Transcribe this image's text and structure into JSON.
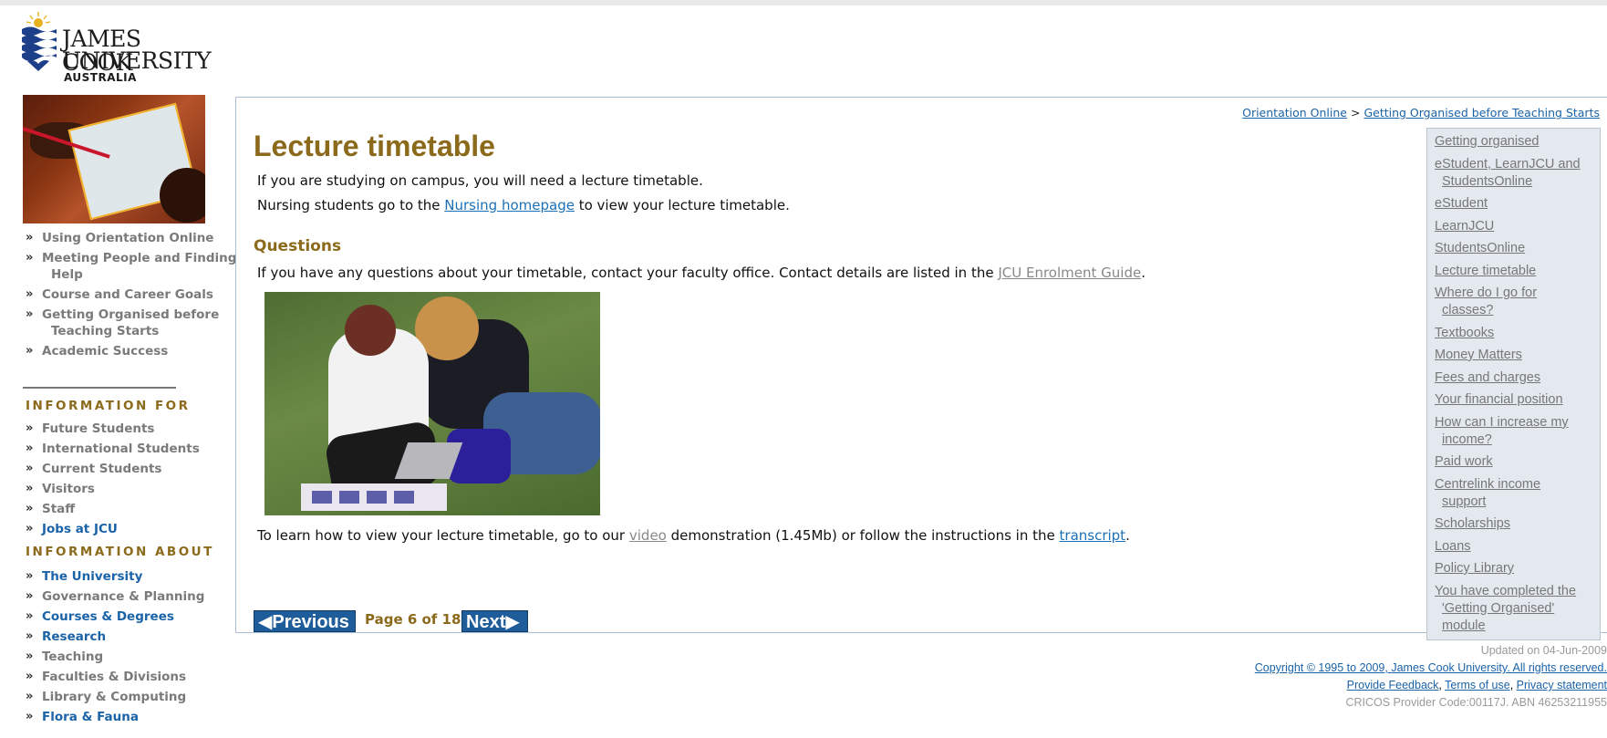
{
  "brand": {
    "line1": "JAMES COOK",
    "line2": "UNIVERSITY",
    "line3": "AUSTRALIA",
    "colors": {
      "wave": "#1d3f8a",
      "sun": "#e8b21e",
      "gold": "#8c6a1c",
      "link": "#1b63a8"
    }
  },
  "sidebar": {
    "nav": [
      {
        "label": "Using Orientation Online"
      },
      {
        "label": "Meeting People and Finding Help",
        "line1": "Meeting People and Finding",
        "line2": "Help"
      },
      {
        "label": "Course and Career Goals"
      },
      {
        "label": "Getting Organised before Teaching Starts",
        "line1": "Getting Organised before",
        "line2": "Teaching Starts"
      },
      {
        "label": "Academic Success"
      }
    ],
    "info_for_heading": "INFORMATION FOR",
    "info_for": [
      {
        "label": "Future Students"
      },
      {
        "label": "International Students"
      },
      {
        "label": "Current Students"
      },
      {
        "label": "Visitors"
      },
      {
        "label": "Staff"
      },
      {
        "label": "Jobs at JCU"
      }
    ],
    "info_about_heading": "INFORMATION ABOUT",
    "info_about": [
      {
        "label": "The University"
      },
      {
        "label": "Governance & Planning"
      },
      {
        "label": "Courses & Degrees"
      },
      {
        "label": "Research"
      },
      {
        "label": "Teaching"
      },
      {
        "label": "Faculties & Divisions"
      },
      {
        "label": "Library & Computing"
      },
      {
        "label": "Flora & Fauna"
      }
    ]
  },
  "breadcrumb": {
    "item1": "Orientation Online",
    "separator": ">",
    "item2": "Getting Organised before Teaching Starts"
  },
  "main": {
    "title": "Lecture timetable",
    "para1": "If you are studying on campus, you will need a lecture timetable.",
    "para2_before": "Nursing students go to the ",
    "para2_link": "Nursing homepage",
    "para2_after": " to view your lecture timetable.",
    "questions_heading": "Questions",
    "para3_before": "If you have any questions about your timetable, contact your faculty office. Contact details are listed in the ",
    "para3_link": "JCU Enrolment Guide",
    "para3_after": ".",
    "para4_before": "To learn how to view your lecture timetable, go to our ",
    "para4_link1": "video",
    "para4_mid": " demonstration (1.45Mb) or follow the instructions in the ",
    "para4_link2": "transcript",
    "para4_after": "."
  },
  "pager": {
    "prev": "Previous",
    "status": "Page 6 of 18",
    "next": "Next"
  },
  "right_nav": {
    "items": [
      {
        "label": "Getting organised "
      },
      {
        "line1": "eStudent, LearnJCU and",
        "line2": "StudentsOnline "
      },
      {
        "label": "eStudent "
      },
      {
        "label": "LearnJCU "
      },
      {
        "label": "StudentsOnline "
      },
      {
        "label": "Lecture timetable "
      },
      {
        "line1": "Where do I go for",
        "line2": "classes? "
      },
      {
        "label": "Textbooks "
      },
      {
        "label": "Money Matters "
      },
      {
        "label": "Fees and charges "
      },
      {
        "label": "Your financial position "
      },
      {
        "line1": "How can I increase my",
        "line2": "income? "
      },
      {
        "label": "Paid work "
      },
      {
        "line1": "Centrelink income",
        "line2": "support "
      },
      {
        "label": "Scholarships "
      },
      {
        "label": "Loans "
      },
      {
        "label": "Policy Library "
      },
      {
        "line1": "You have completed the",
        "line2": "'Getting Organised'",
        "line3": "module "
      }
    ]
  },
  "footer": {
    "updated": "Updated on 04-Jun-2009",
    "copyright": "Copyright © 1995 to 2009, James Cook University. All rights reserved.",
    "feedback": "Provide Feedback",
    "terms": "Terms of use",
    "privacy": "Privacy statement",
    "cricos": "CRICOS Provider Code:00117J.  ABN 46253211955"
  }
}
